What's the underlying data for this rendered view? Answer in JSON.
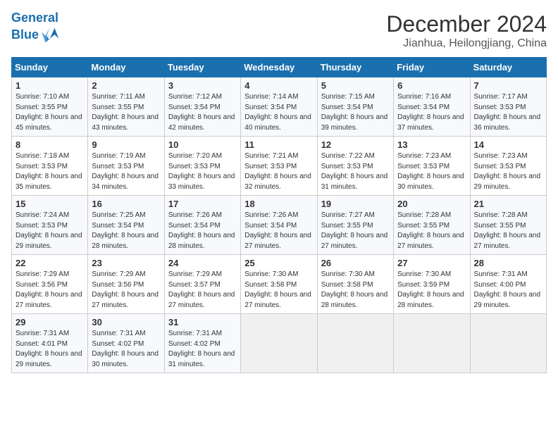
{
  "header": {
    "logo_line1": "General",
    "logo_line2": "Blue",
    "month": "December 2024",
    "location": "Jianhua, Heilongjiang, China"
  },
  "weekdays": [
    "Sunday",
    "Monday",
    "Tuesday",
    "Wednesday",
    "Thursday",
    "Friday",
    "Saturday"
  ],
  "weeks": [
    [
      {
        "day": "1",
        "sunrise": "7:10 AM",
        "sunset": "3:55 PM",
        "daylight": "8 hours and 45 minutes."
      },
      {
        "day": "2",
        "sunrise": "7:11 AM",
        "sunset": "3:55 PM",
        "daylight": "8 hours and 43 minutes."
      },
      {
        "day": "3",
        "sunrise": "7:12 AM",
        "sunset": "3:54 PM",
        "daylight": "8 hours and 42 minutes."
      },
      {
        "day": "4",
        "sunrise": "7:14 AM",
        "sunset": "3:54 PM",
        "daylight": "8 hours and 40 minutes."
      },
      {
        "day": "5",
        "sunrise": "7:15 AM",
        "sunset": "3:54 PM",
        "daylight": "8 hours and 39 minutes."
      },
      {
        "day": "6",
        "sunrise": "7:16 AM",
        "sunset": "3:54 PM",
        "daylight": "8 hours and 37 minutes."
      },
      {
        "day": "7",
        "sunrise": "7:17 AM",
        "sunset": "3:53 PM",
        "daylight": "8 hours and 36 minutes."
      }
    ],
    [
      {
        "day": "8",
        "sunrise": "7:18 AM",
        "sunset": "3:53 PM",
        "daylight": "8 hours and 35 minutes."
      },
      {
        "day": "9",
        "sunrise": "7:19 AM",
        "sunset": "3:53 PM",
        "daylight": "8 hours and 34 minutes."
      },
      {
        "day": "10",
        "sunrise": "7:20 AM",
        "sunset": "3:53 PM",
        "daylight": "8 hours and 33 minutes."
      },
      {
        "day": "11",
        "sunrise": "7:21 AM",
        "sunset": "3:53 PM",
        "daylight": "8 hours and 32 minutes."
      },
      {
        "day": "12",
        "sunrise": "7:22 AM",
        "sunset": "3:53 PM",
        "daylight": "8 hours and 31 minutes."
      },
      {
        "day": "13",
        "sunrise": "7:23 AM",
        "sunset": "3:53 PM",
        "daylight": "8 hours and 30 minutes."
      },
      {
        "day": "14",
        "sunrise": "7:23 AM",
        "sunset": "3:53 PM",
        "daylight": "8 hours and 29 minutes."
      }
    ],
    [
      {
        "day": "15",
        "sunrise": "7:24 AM",
        "sunset": "3:53 PM",
        "daylight": "8 hours and 29 minutes."
      },
      {
        "day": "16",
        "sunrise": "7:25 AM",
        "sunset": "3:54 PM",
        "daylight": "8 hours and 28 minutes."
      },
      {
        "day": "17",
        "sunrise": "7:26 AM",
        "sunset": "3:54 PM",
        "daylight": "8 hours and 28 minutes."
      },
      {
        "day": "18",
        "sunrise": "7:26 AM",
        "sunset": "3:54 PM",
        "daylight": "8 hours and 27 minutes."
      },
      {
        "day": "19",
        "sunrise": "7:27 AM",
        "sunset": "3:55 PM",
        "daylight": "8 hours and 27 minutes."
      },
      {
        "day": "20",
        "sunrise": "7:28 AM",
        "sunset": "3:55 PM",
        "daylight": "8 hours and 27 minutes."
      },
      {
        "day": "21",
        "sunrise": "7:28 AM",
        "sunset": "3:55 PM",
        "daylight": "8 hours and 27 minutes."
      }
    ],
    [
      {
        "day": "22",
        "sunrise": "7:29 AM",
        "sunset": "3:56 PM",
        "daylight": "8 hours and 27 minutes."
      },
      {
        "day": "23",
        "sunrise": "7:29 AM",
        "sunset": "3:56 PM",
        "daylight": "8 hours and 27 minutes."
      },
      {
        "day": "24",
        "sunrise": "7:29 AM",
        "sunset": "3:57 PM",
        "daylight": "8 hours and 27 minutes."
      },
      {
        "day": "25",
        "sunrise": "7:30 AM",
        "sunset": "3:58 PM",
        "daylight": "8 hours and 27 minutes."
      },
      {
        "day": "26",
        "sunrise": "7:30 AM",
        "sunset": "3:58 PM",
        "daylight": "8 hours and 28 minutes."
      },
      {
        "day": "27",
        "sunrise": "7:30 AM",
        "sunset": "3:59 PM",
        "daylight": "8 hours and 28 minutes."
      },
      {
        "day": "28",
        "sunrise": "7:31 AM",
        "sunset": "4:00 PM",
        "daylight": "8 hours and 29 minutes."
      }
    ],
    [
      {
        "day": "29",
        "sunrise": "7:31 AM",
        "sunset": "4:01 PM",
        "daylight": "8 hours and 29 minutes."
      },
      {
        "day": "30",
        "sunrise": "7:31 AM",
        "sunset": "4:02 PM",
        "daylight": "8 hours and 30 minutes."
      },
      {
        "day": "31",
        "sunrise": "7:31 AM",
        "sunset": "4:02 PM",
        "daylight": "8 hours and 31 minutes."
      },
      null,
      null,
      null,
      null
    ]
  ]
}
